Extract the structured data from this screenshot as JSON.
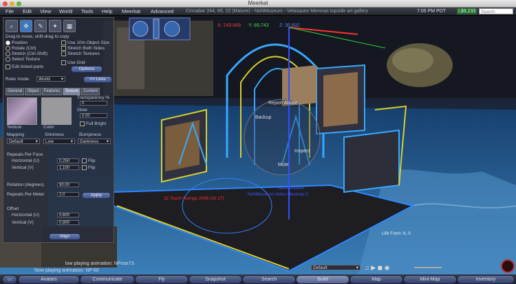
{
  "window": {
    "title": "Meerkat"
  },
  "menubar": {
    "items": [
      "File",
      "Edit",
      "View",
      "World",
      "Tools",
      "Help",
      "Meerkat",
      "Advanced"
    ],
    "location": "Cinnabar 244, 86, 22 (Mature) - NoNMuseum - Velasquez Meninas topside art gallery",
    "clock": "7:05 PM PDT",
    "balance": "L$9,233",
    "search_placeholder": "Search"
  },
  "hud": {
    "x": "X: 243.669",
    "y": "Y: 89.743",
    "z": "Z: 30.832"
  },
  "pie_menu": {
    "report": "Report Abuse...",
    "backup": "Backup",
    "inspect": "Inspect",
    "mute": "Mute"
  },
  "scene_labels": {
    "red": "22 Touch Swings 2006 (10 27)",
    "blue1": "NoNMuseum",
    "blue2": "NoNMuseum Video Meninas 2",
    "life": "Life Form: 6, 0"
  },
  "build": {
    "hint": "Drag to move, shift-drag to copy",
    "position": "Position",
    "rotate": "Rotate (Ctrl)",
    "stretch": "Stretch (Ctrl-Shift)",
    "select_texture": "Select Texture",
    "edit_linked": "Edit linked parts",
    "check_10m": "Use 10m Object Size",
    "check_both": "Stretch Both Sides",
    "check_textures": "Stretch Textures",
    "check_grid": "Use Grid",
    "options": "Options",
    "ruler_label": "Ruler mode:",
    "ruler_value": "World",
    "less": "<< Less",
    "tabs": [
      "General",
      "Object",
      "Features",
      "Texture",
      "Content"
    ],
    "texture_label": "Texture",
    "color_label": "Color",
    "transparency": "Transparency %",
    "transparency_value": "0",
    "glow": "Glow",
    "glow_value": "0.00",
    "full_bright": "Full Bright",
    "mapping": "Mapping",
    "shininess": "Shininess",
    "bumpiness": "Bumpiness",
    "mapping_value": "Default",
    "shininess_value": "Low",
    "bumpiness_value": "Darkness",
    "repeats": "Repeats Per Face",
    "horizontal_u": "Horizontal (U)",
    "vertical_v": "Vertical (V)",
    "rep_u": "0.250",
    "rep_v": "1.100",
    "flip": "Flip",
    "rotation": "Rotation (degrees)",
    "rotation_value": "90.00",
    "repeats_meter": "Repeats Per Meter",
    "repeats_meter_value": "2.0",
    "apply": "Apply",
    "offset": "Offset",
    "off_h": "Horizontal (U)",
    "off_v": "Vertical (V)",
    "off_u_value": "0.600",
    "off_v_value": "0.800",
    "align": "Align"
  },
  "chat": {
    "line1": "low playing animation: NPose73",
    "line2": "Now playing animation: NP 60"
  },
  "bottom": {
    "buttons": [
      "Avatars",
      "Communicate",
      "Fly",
      "Snapshot",
      "Search",
      "Build",
      "Map",
      "Mini-Map",
      "Inventory"
    ],
    "preset": "Default"
  }
}
